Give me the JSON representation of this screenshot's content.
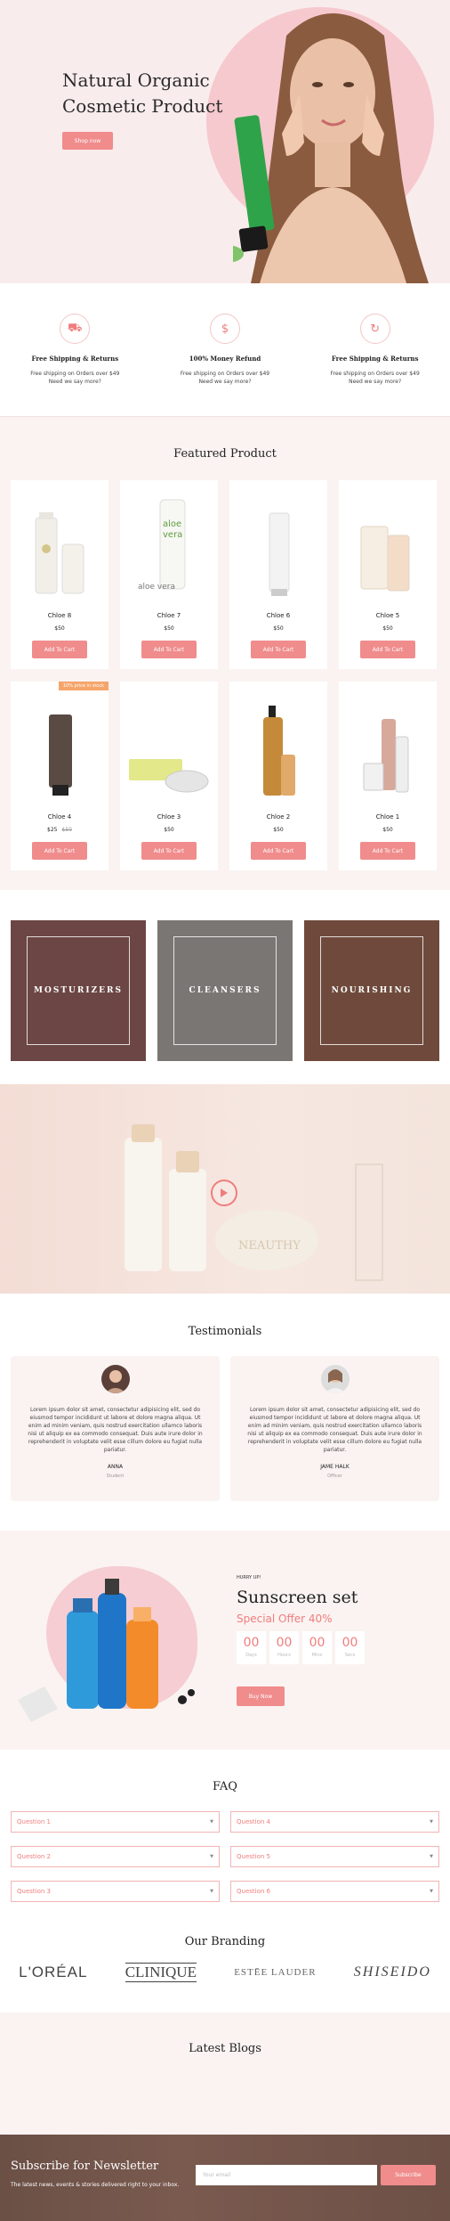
{
  "hero": {
    "title_line1": "Natural Organic",
    "title_line2": "Cosmetic Product",
    "button": "Shop now"
  },
  "features": [
    {
      "icon": "truck-icon",
      "title": "Free Shipping & Returns",
      "text_line1": "Free shipping on Orders over $49",
      "text_line2": "Need we say more?"
    },
    {
      "icon": "money-refund-icon",
      "title": "100% Money Refund",
      "text_line1": "Free shipping on Orders over $49",
      "text_line2": "Need we say more?"
    },
    {
      "icon": "refresh-icon",
      "title": "Free Shipping & Returns",
      "text_line1": "Free shipping on Orders over $49",
      "text_line2": "Need we say more?"
    }
  ],
  "featured": {
    "title": "Featured Product",
    "add_to_cart": "Add To Cart",
    "sale_badge": "10% price in stock",
    "products": [
      {
        "name": "Chloe 8",
        "price": "$50"
      },
      {
        "name": "Chloe 7",
        "price": "$50"
      },
      {
        "name": "Chloe 6",
        "price": "$50"
      },
      {
        "name": "Chloe 5",
        "price": "$50"
      },
      {
        "name": "Chloe 4",
        "price": "$25",
        "old_price": "$50"
      },
      {
        "name": "Chloe 3",
        "price": "$50"
      },
      {
        "name": "Chloe 2",
        "price": "$50"
      },
      {
        "name": "Chloe 1",
        "price": "$50"
      }
    ]
  },
  "categories": [
    "MOSTURIZERS",
    "CLEANSERS",
    "NOURISHING"
  ],
  "video": {
    "play_icon": "play-icon",
    "brand_text": "NEAUTHY"
  },
  "testimonials": {
    "title": "Testimonials",
    "items": [
      {
        "text": "Lorem ipsum dolor sit amet, consectetur adipisicing elit, sed do eiusmod tempor incididunt ut labore et dolore magna aliqua. Ut enim ad minim veniam, quis nostrud exercitation ullamco laboris nisi ut aliquip ex ea commodo consequat. Duis aute irure dolor in reprehenderit in voluptate velit esse cillum dolore eu fugiat nulla pariatur.",
        "name": "ANNA",
        "role": "Student"
      },
      {
        "text": "Lorem ipsum dolor sit amet, consectetur adipisicing elit, sed do eiusmod tempor incididunt ut labore et dolore magna aliqua. Ut enim ad minim veniam, quis nostrud exercitation ullamco laboris nisi ut aliquip ex ea commodo consequat. Duis aute irure dolor in reprehenderit in voluptate velit esse cillum dolore eu fugiat nulla pariatur.",
        "name": "JAME HALK",
        "role": "Officer"
      }
    ]
  },
  "promo": {
    "hurry": "HURRY UP!",
    "title": "Sunscreen set",
    "offer": "Special Offer 40%",
    "countdown": [
      {
        "value": "00",
        "label": "Days"
      },
      {
        "value": "00",
        "label": "Hours"
      },
      {
        "value": "00",
        "label": "Mins"
      },
      {
        "value": "00",
        "label": "Secs"
      }
    ],
    "button": "Buy Now"
  },
  "faq": {
    "title": "FAQ",
    "questions": [
      "Question 1",
      "Question 4",
      "Question 2",
      "Question 5",
      "Question 3",
      "Question 6"
    ]
  },
  "branding": {
    "title": "Our Branding",
    "brands": [
      "L'ORÉAL",
      "CLINIQUE",
      "ESTĒE LAUDER",
      "SHISEIDO"
    ]
  },
  "blogs": {
    "title": "Latest Blogs"
  },
  "newsletter": {
    "title": "Subscribe for Newsletter",
    "subtitle": "The latest news, events & stories delivered right to your inbox.",
    "placeholder": "Your email",
    "button": "Subscribe"
  },
  "colors": {
    "accent": "#f08c8c",
    "pink_bg": "#f9ecec",
    "section_bg": "#faf3f2"
  }
}
